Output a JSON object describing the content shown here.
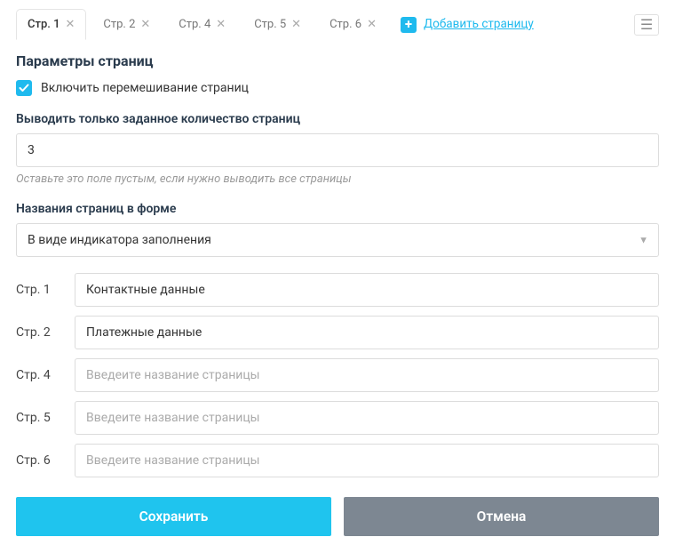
{
  "tabs": [
    {
      "label": "Стр. 1",
      "active": true
    },
    {
      "label": "Стр. 2",
      "active": false
    },
    {
      "label": "Стр. 4",
      "active": false
    },
    {
      "label": "Стр. 5",
      "active": false
    },
    {
      "label": "Стр. 6",
      "active": false
    }
  ],
  "add_page_label": "Добавить страницу",
  "section_title": "Параметры страниц",
  "shuffle": {
    "checked": true,
    "label": "Включить перемешивание страниц"
  },
  "limit": {
    "label": "Выводить только заданное количество страниц",
    "value": "3",
    "hint": "Оставьте это поле пустым, если нужно выводить все страницы"
  },
  "names_section": {
    "label": "Названия страниц в форме",
    "select_value": "В виде индикатора заполнения"
  },
  "page_names": [
    {
      "label": "Стр. 1",
      "value": "Контактные данные",
      "placeholder": ""
    },
    {
      "label": "Стр. 2",
      "value": "Платежные данные",
      "placeholder": ""
    },
    {
      "label": "Стр. 4",
      "value": "",
      "placeholder": "Введеите название страницы"
    },
    {
      "label": "Стр. 5",
      "value": "",
      "placeholder": "Введеите название страницы"
    },
    {
      "label": "Стр. 6",
      "value": "",
      "placeholder": "Введеите название страницы"
    }
  ],
  "buttons": {
    "save": "Сохранить",
    "cancel": "Отмена"
  }
}
